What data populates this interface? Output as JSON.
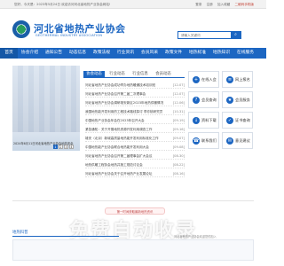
{
  "topbar": {
    "welcome": "您好，今天是：2023年5月24日 欢迎访问河北省地热产业协会网站!",
    "links": [
      "登录",
      "注册",
      "加入收藏"
    ],
    "qr_link": "二维码手机版"
  },
  "header": {
    "title_cn": "河北省地热产业协会",
    "title_en": "GEOTHERMAL INDUSTRY ASSOCIATION",
    "search_placeholder": "请输入关键词",
    "search_icon": "search-icon"
  },
  "nav": {
    "items": [
      "首页",
      "协会介绍",
      "通知公告",
      "动态信息",
      "政策法规",
      "行业资讯",
      "会员风采",
      "政策文件",
      "地热标准",
      "地热知识",
      "在线服务"
    ],
    "active_index": 0
  },
  "banner": {
    "pages": [
      "1",
      "2",
      "3",
      "4"
    ],
    "active_page": "1",
    "caption": "2024年6月11日河北省地热产业协会地热安全"
  },
  "news": {
    "tabs": [
      "协会动态",
      "行业动态",
      "行业信息",
      "会员动态"
    ],
    "active_tab": 0,
    "rows": [
      {
        "title": "河北省地热产业协会成功举办地热暖通技术培训班",
        "date": "[12-07]"
      },
      {
        "title": "河北省地热产业协会召开第二届二次理事会",
        "date": "[12-07]"
      },
      {
        "title": "河北省地热产业协会调研雄安新区2023年地热供暖情况",
        "date": "[12-06]"
      },
      {
        "title": "我国地热能开发利用的工程技术路线探讨 李亦桃研究员",
        "date": "[10-31]"
      },
      {
        "title": "中国地热产业协会年会在2023年召开大会",
        "date": "[09-19]"
      },
      {
        "title": "紧急通知：关于开展地热资源开发利用调查工作",
        "date": "[09-16]"
      },
      {
        "title": "雄安（北京）新城高质量地热能开发利用标准化工作",
        "date": "[09-07]"
      },
      {
        "title": "中国地热能产业协会联合地热能开发利用大会",
        "date": "[09-08]"
      },
      {
        "title": "河北省地热产业协会召开第二届理事会扩大会议",
        "date": "[08-30]"
      },
      {
        "title": "地热供暖工程协会地热井施工规范讨论会",
        "date": "[08-22]"
      },
      {
        "title": "河北省地热产业协会关于召开地热产业发展论坛",
        "date": "[08-16]"
      }
    ]
  },
  "quick": {
    "buttons": [
      {
        "label": "在线入会",
        "icon": "user-plus-icon"
      },
      {
        "label": "网上报名",
        "icon": "clipboard-icon"
      },
      {
        "label": "会员查询",
        "icon": "search-user-icon"
      },
      {
        "label": "会员服务",
        "icon": "service-icon"
      },
      {
        "label": "资料下载",
        "icon": "download-icon"
      },
      {
        "label": "证书查询",
        "icon": "certificate-icon"
      },
      {
        "label": "联系我们",
        "icon": "phone-icon"
      },
      {
        "label": "意见建议",
        "icon": "message-icon"
      }
    ]
  },
  "ad": {
    "bubble": "第一时间获取最新地热资讯",
    "big_text": "免费自动收录"
  },
  "bottom": {
    "section_label": "地热科普",
    "note": "河北省地热产业协会欢迎您的加入"
  }
}
